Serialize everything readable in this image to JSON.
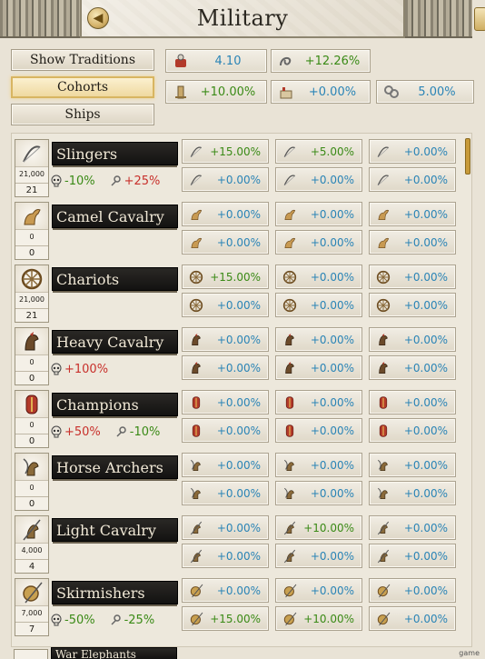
{
  "header": {
    "title": "Military"
  },
  "tabs": [
    {
      "label": "Show Traditions",
      "active": false
    },
    {
      "label": "Cohorts",
      "active": true
    },
    {
      "label": "Ships",
      "active": false
    }
  ],
  "stats": [
    {
      "icon": "manpower-icon",
      "value": "4.10",
      "color": "blue"
    },
    {
      "icon": "rope-icon",
      "value": "+12.26%",
      "color": "green"
    },
    {
      "icon": "building-icon",
      "value": "+10.00%",
      "color": "green"
    },
    {
      "icon": "fortress-icon",
      "value": "+0.00%",
      "color": "blue"
    },
    {
      "icon": "shackles-icon",
      "value": "5.00%",
      "color": "blue"
    }
  ],
  "units": [
    {
      "name": "Slingers",
      "icon": "sling-icon",
      "max": "21,000",
      "current": "21",
      "mods": [
        {
          "icon": "skull-icon",
          "value": "-10%",
          "color": "green"
        },
        {
          "icon": "upkeep-icon",
          "value": "+25%",
          "color": "red"
        }
      ],
      "cells": [
        {
          "value": "+15.00%",
          "color": "green"
        },
        {
          "value": "+5.00%",
          "color": "green"
        },
        {
          "value": "+0.00%",
          "color": "blue"
        },
        {
          "value": "+0.00%",
          "color": "blue"
        },
        {
          "value": "+0.00%",
          "color": "blue"
        },
        {
          "value": "+0.00%",
          "color": "blue"
        }
      ]
    },
    {
      "name": "Camel Cavalry",
      "icon": "camel-icon",
      "max": "0",
      "current": "0",
      "mods": [],
      "cells": [
        {
          "value": "+0.00%",
          "color": "blue"
        },
        {
          "value": "+0.00%",
          "color": "blue"
        },
        {
          "value": "+0.00%",
          "color": "blue"
        },
        {
          "value": "+0.00%",
          "color": "blue"
        },
        {
          "value": "+0.00%",
          "color": "blue"
        },
        {
          "value": "+0.00%",
          "color": "blue"
        }
      ]
    },
    {
      "name": "Chariots",
      "icon": "wheel-icon",
      "max": "21,000",
      "current": "21",
      "mods": [],
      "cells": [
        {
          "value": "+15.00%",
          "color": "green"
        },
        {
          "value": "+0.00%",
          "color": "blue"
        },
        {
          "value": "+0.00%",
          "color": "blue"
        },
        {
          "value": "+0.00%",
          "color": "blue"
        },
        {
          "value": "+0.00%",
          "color": "blue"
        },
        {
          "value": "+0.00%",
          "color": "blue"
        }
      ]
    },
    {
      "name": "Heavy Cavalry",
      "icon": "armored-horse-icon",
      "max": "0",
      "current": "0",
      "mods": [
        {
          "icon": "skull-icon",
          "value": "+100%",
          "color": "red"
        }
      ],
      "cells": [
        {
          "value": "+0.00%",
          "color": "blue"
        },
        {
          "value": "+0.00%",
          "color": "blue"
        },
        {
          "value": "+0.00%",
          "color": "blue"
        },
        {
          "value": "+0.00%",
          "color": "blue"
        },
        {
          "value": "+0.00%",
          "color": "blue"
        },
        {
          "value": "+0.00%",
          "color": "blue"
        }
      ]
    },
    {
      "name": "Champions",
      "icon": "shield-icon",
      "max": "0",
      "current": "0",
      "mods": [
        {
          "icon": "skull-icon",
          "value": "+50%",
          "color": "red"
        },
        {
          "icon": "upkeep-icon",
          "value": "-10%",
          "color": "green"
        }
      ],
      "cells": [
        {
          "value": "+0.00%",
          "color": "blue"
        },
        {
          "value": "+0.00%",
          "color": "blue"
        },
        {
          "value": "+0.00%",
          "color": "blue"
        },
        {
          "value": "+0.00%",
          "color": "blue"
        },
        {
          "value": "+0.00%",
          "color": "blue"
        },
        {
          "value": "+0.00%",
          "color": "blue"
        }
      ]
    },
    {
      "name": "Horse Archers",
      "icon": "horse-bow-icon",
      "max": "0",
      "current": "0",
      "mods": [],
      "cells": [
        {
          "value": "+0.00%",
          "color": "blue"
        },
        {
          "value": "+0.00%",
          "color": "blue"
        },
        {
          "value": "+0.00%",
          "color": "blue"
        },
        {
          "value": "+0.00%",
          "color": "blue"
        },
        {
          "value": "+0.00%",
          "color": "blue"
        },
        {
          "value": "+0.00%",
          "color": "blue"
        }
      ]
    },
    {
      "name": "Light Cavalry",
      "icon": "horse-spear-icon",
      "max": "4,000",
      "current": "4",
      "mods": [],
      "cells": [
        {
          "value": "+0.00%",
          "color": "blue"
        },
        {
          "value": "+10.00%",
          "color": "green"
        },
        {
          "value": "+0.00%",
          "color": "blue"
        },
        {
          "value": "+0.00%",
          "color": "blue"
        },
        {
          "value": "+0.00%",
          "color": "blue"
        },
        {
          "value": "+0.00%",
          "color": "blue"
        }
      ]
    },
    {
      "name": "Skirmishers",
      "icon": "javelin-shield-icon",
      "max": "7,000",
      "current": "7",
      "mods": [
        {
          "icon": "skull-icon",
          "value": "-50%",
          "color": "green"
        },
        {
          "icon": "upkeep-icon",
          "value": "-25%",
          "color": "green"
        }
      ],
      "cells": [
        {
          "value": "+0.00%",
          "color": "blue"
        },
        {
          "value": "+0.00%",
          "color": "blue"
        },
        {
          "value": "+0.00%",
          "color": "blue"
        },
        {
          "value": "+15.00%",
          "color": "green"
        },
        {
          "value": "+10.00%",
          "color": "green"
        },
        {
          "value": "+0.00%",
          "color": "blue"
        }
      ]
    }
  ],
  "partial_unit": {
    "name": "War Elephants"
  },
  "watermark": "game"
}
